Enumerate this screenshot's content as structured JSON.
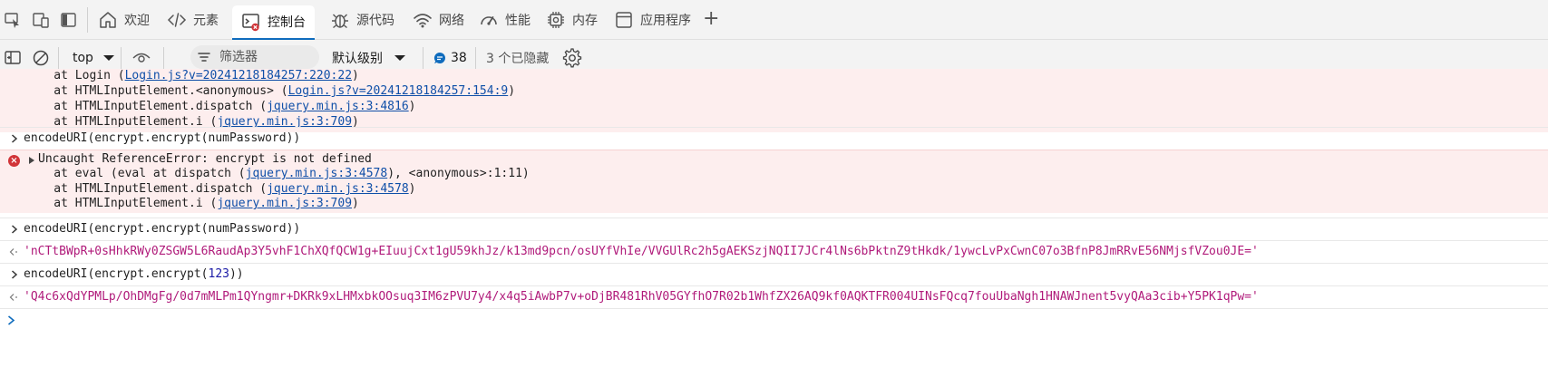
{
  "tabs": {
    "welcome": "欢迎",
    "elements": "元素",
    "console": "控制台",
    "sources": "源代码",
    "network": "网络",
    "performance": "性能",
    "memory": "内存",
    "application": "应用程序",
    "add": "+"
  },
  "toolbar": {
    "context": "top",
    "filter_placeholder": "筛选器",
    "level": "默认级别",
    "issue_count": "38",
    "hidden": "3 个已隐藏"
  },
  "console": {
    "err1": {
      "line0_prefix": "    at Login (",
      "line0_link": "Login.js?v=20241218184257:220:22",
      "line0_suffix": ")",
      "line1_prefix": "    at HTMLInputElement.<anonymous> (",
      "line1_link": "Login.js?v=20241218184257:154:9",
      "line1_suffix": ")",
      "line2_prefix": "    at HTMLInputElement.dispatch (",
      "line2_link": "jquery.min.js:3:4816",
      "line2_suffix": ")",
      "line3_prefix": "    at HTMLInputElement.i (",
      "line3_link": "jquery.min.js:3:709",
      "line3_suffix": ")"
    },
    "cmd1": "encodeURI(encrypt.encrypt(numPassword))",
    "err2": {
      "title": "Uncaught ReferenceError: encrypt is not defined",
      "line1_prefix": "    at eval (eval at dispatch (",
      "line1_link": "jquery.min.js:3:4578",
      "line1_suffix": "), <anonymous>:1:11)",
      "line2_prefix": "    at HTMLInputElement.dispatch (",
      "line2_link": "jquery.min.js:3:4578",
      "line2_suffix": ")",
      "line3_prefix": "    at HTMLInputElement.i (",
      "line3_link": "jquery.min.js:3:709",
      "line3_suffix": ")"
    },
    "cmd2": "encodeURI(encrypt.encrypt(numPassword))",
    "result2": "'nCTtBWpR+0sHhkRWy0ZSGW5L6RaudAp3Y5vhF1ChXQfQCW1g+EIuujCxt1gU59khJz/k13md9pcn/osUYfVhIe/VVGUlRc2h5gAEKSzjNQII7JCr4lNs6bPktnZ9tHkdk/1ywcLvPxCwnC07o3BfnP8JmRRvE56NMjsfVZou0JE='",
    "cmd3_prefix": "encodeURI(encrypt.encrypt(",
    "cmd3_num": "123",
    "cmd3_suffix": "))",
    "result3": "'Q4c6xQdYPMLp/OhDMgFg/0d7mMLPm1QYngmr+DKRk9xLHMxbkOOsuq3IM6zPVU7y4/x4q5iAwbP7v+oDjBR481RhV05GYfhO7R02b1WhfZX26AQ9kf0AQKTFR004UINsFQcq7fouUbaNgh1HNAWJnent5vyQAa3cib+Y5PK1qPw='"
  },
  "colors": {
    "accent": "#0f6cbd",
    "error": "#d13438",
    "error_bg": "#fdeeee",
    "string": "#b01a7a",
    "link": "#0f4fa8"
  }
}
